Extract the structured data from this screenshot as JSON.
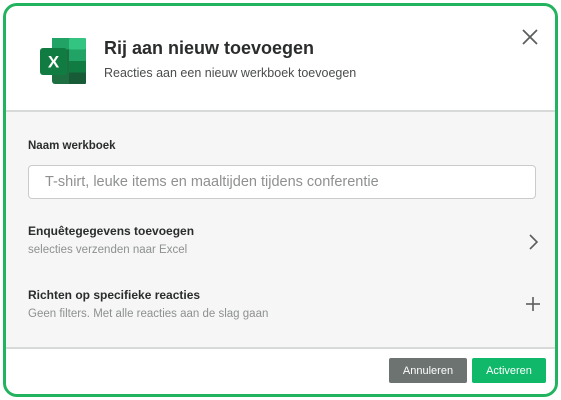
{
  "dialog": {
    "title": "Rij aan nieuw toevoegen",
    "subtitle": "Reacties aan een nieuw werkboek toevoegen",
    "app_icon": "excel-icon",
    "app_icon_letter": "X",
    "close_icon": "close-icon"
  },
  "workbook": {
    "label": "Naam werkboek",
    "placeholder": "T-shirt, leuke items en maaltijden tijdens conferentie",
    "value": ""
  },
  "options": [
    {
      "title": "Enquêtegegevens toevoegen",
      "subtitle": "selecties verzenden naar Excel",
      "icon": "chevron-right-icon"
    },
    {
      "title": "Richten op specifieke reacties",
      "subtitle": "Geen filters. Met alle reacties aan de slag gaan",
      "icon": "plus-icon"
    }
  ],
  "footer": {
    "cancel_label": "Annuleren",
    "activate_label": "Activeren"
  },
  "colors": {
    "frame_border": "#22b35e",
    "cancel_button": "#6c7370",
    "activate_button": "#10b86a",
    "excel_green": "#1d6f42"
  }
}
